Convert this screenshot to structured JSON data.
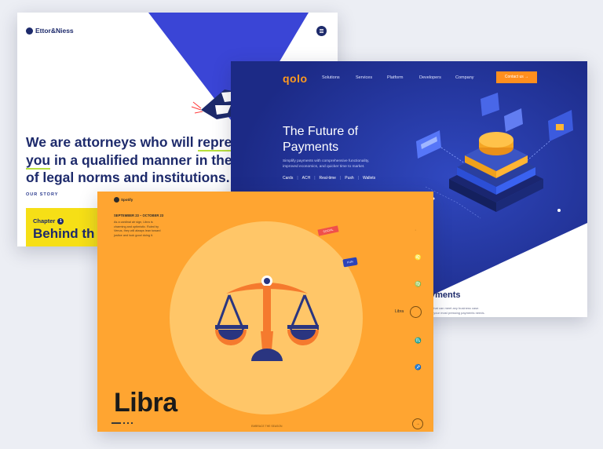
{
  "ettor": {
    "logo": "Ettor&Niess",
    "headline_line1_a": "We are attorneys who will ",
    "headline_line1_b": "represen",
    "headline_line2_a": "you",
    "headline_line2_b": " in a qualified manner in the wo",
    "headline_line3": "of legal norms and institutions.",
    "story_label": "OUR STORY",
    "chapter_label": "Chapter",
    "chapter_number": "1",
    "chapter_title": "Behind th",
    "colors": {
      "navy": "#1d2a6b",
      "accent_blue": "#3a45d6",
      "yellow": "#f6df16",
      "lime": "#b8e03c"
    }
  },
  "qolo": {
    "brand": "qolo",
    "nav": [
      "Solutions",
      "Services",
      "Platform",
      "Developers",
      "Company"
    ],
    "contact_button": "Contact us →",
    "title_line1": "The Future of",
    "title_line2": "Payments",
    "desc_line1": "Simplify payments with comprehensive functionality,",
    "desc_line2": "improved economics, and quicker time to market.",
    "links": [
      "Cards",
      "ACH",
      "Real-time",
      "Push",
      "Wallets"
    ],
    "payments_heading": "yments",
    "payments_sub_line1": "s that can meet any business case.",
    "payments_sub_line2": "ip your most pressing payments needs.",
    "colors": {
      "bg": "#243a9e",
      "orange": "#ff8f1e"
    }
  },
  "libra": {
    "brand": "Spotify",
    "dates": "SEPTEMBER 23 – OCTOBER 23",
    "blurb_lines": [
      "As a cardinal air sign, Libra is",
      "charming and optimistic. Ruled by",
      "Venus, they will always lean toward",
      "justice and look good doing it."
    ],
    "tag_social": "SOCIAL",
    "tag_fun": "FUN",
    "side_label": "Libra",
    "title": "Libra",
    "footer": "EMBRACE THE SEASON",
    "go_icon": "arrow-right",
    "colors": {
      "bg": "#ffa531",
      "circle": "#ffc668",
      "scale_orange": "#f57a2e",
      "scale_navy": "#2a3580"
    }
  }
}
